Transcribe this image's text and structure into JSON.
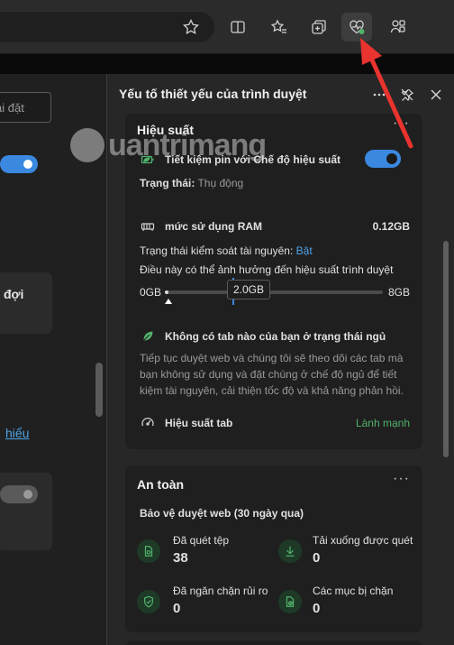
{
  "toolbar": {
    "icons": [
      "favorite-star-icon",
      "split-screen-icon",
      "favorites-icon",
      "collections-icon",
      "browser-essentials-icon",
      "extensions-icon"
    ]
  },
  "settings_page": {
    "search_placeholder_fragment": "ài đặt",
    "card_text_fragment": "đợi",
    "link_fragment": "hiểu"
  },
  "watermark": "uantrimang",
  "panel": {
    "title": "Yếu tố thiết yếu của trình duyệt",
    "performance": {
      "title": "Hiệu suất",
      "efficiency_label": "Tiết kiệm pin với Chế độ hiệu suất",
      "efficiency_on": true,
      "status_label": "Trạng thái:",
      "status_value": "Thụ động",
      "ram_label": "mức sử dụng RAM",
      "ram_value": "0.12GB",
      "resource_control_label": "Trạng thái kiểm soát tài nguyên:",
      "resource_control_value": "Bật",
      "impact_note": "Điều này có thể ảnh hưởng đến hiệu suất trình duyệt",
      "slider_min": "0GB",
      "slider_marker": "2.0GB",
      "slider_max": "8GB",
      "slider_current_fraction": 0.015,
      "slider_marker_fraction": 0.25,
      "sleeping_tabs_title": "Không có tab nào của bạn ở trạng thái ngủ",
      "sleeping_tabs_desc": "Tiếp tục duyệt web và chúng tôi sẽ theo dõi các tab mà bạn không sử dụng và đặt chúng ở chế độ ngủ để tiết kiệm tài nguyên, cải thiện tốc độ và khả năng phản hồi.",
      "tab_perf_label": "Hiệu suất tab",
      "tab_perf_value": "Lành mạnh"
    },
    "safety": {
      "title": "An toàn",
      "subtitle": "Bảo vệ duyệt web (30 ngày qua)",
      "stats": [
        {
          "label": "Đã quét tệp",
          "value": "38",
          "icon": "scan-file-icon"
        },
        {
          "label": "Tải xuống được quét",
          "value": "0",
          "icon": "download-icon"
        },
        {
          "label": "Đã ngăn chặn rủi ro",
          "value": "0",
          "icon": "shield-check-icon"
        },
        {
          "label": "Các mục bị chặn",
          "value": "0",
          "icon": "blocked-file-icon"
        }
      ]
    }
  },
  "colors": {
    "accent": "#3a88e0",
    "positive": "#51b26b",
    "arrow": "#e8332e"
  }
}
